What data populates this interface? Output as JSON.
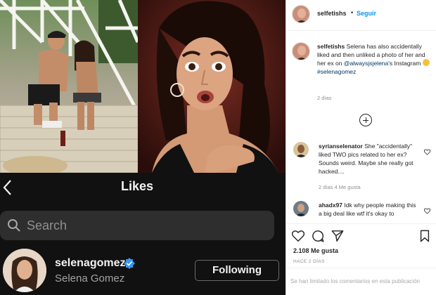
{
  "likes_screen": {
    "title": "Likes",
    "search_placeholder": "Search",
    "user": {
      "handle": "selenagomez",
      "full_name": "Selena Gomez",
      "follow_button": "Following"
    }
  },
  "post": {
    "author": "selfetishs",
    "separator": "•",
    "follow_label": "Seguir",
    "caption": {
      "author": "selfetishs",
      "text_before": " Selena has also accidentally liked and then unliked a photo of her and her ex on ",
      "mention": "@alwaysjsjelena",
      "text_after": "'s Instagram ",
      "hashtag": "#selenagomez",
      "meta": "2 días"
    },
    "comments": [
      {
        "author": "syrianselenator",
        "text": " She \"accidentally\" liked TWO pics related to her ex? Sounds weird. Maybe she really got hacked....",
        "meta": "2 días   4 Me gusta"
      },
      {
        "author": "ahadx97",
        "text": " Idk why people making this a big deal like wtf it's okay to",
        "meta": ""
      }
    ],
    "likes_count": "2.108 Me gusta",
    "time": "HACE 2 DÍAS",
    "comments_closed": "Se han limitado los comentarios en esta publicación"
  },
  "colors": {
    "accent_blue": "#0095f6",
    "dark_bg": "#111111",
    "search_bg": "#2e2e2e"
  }
}
